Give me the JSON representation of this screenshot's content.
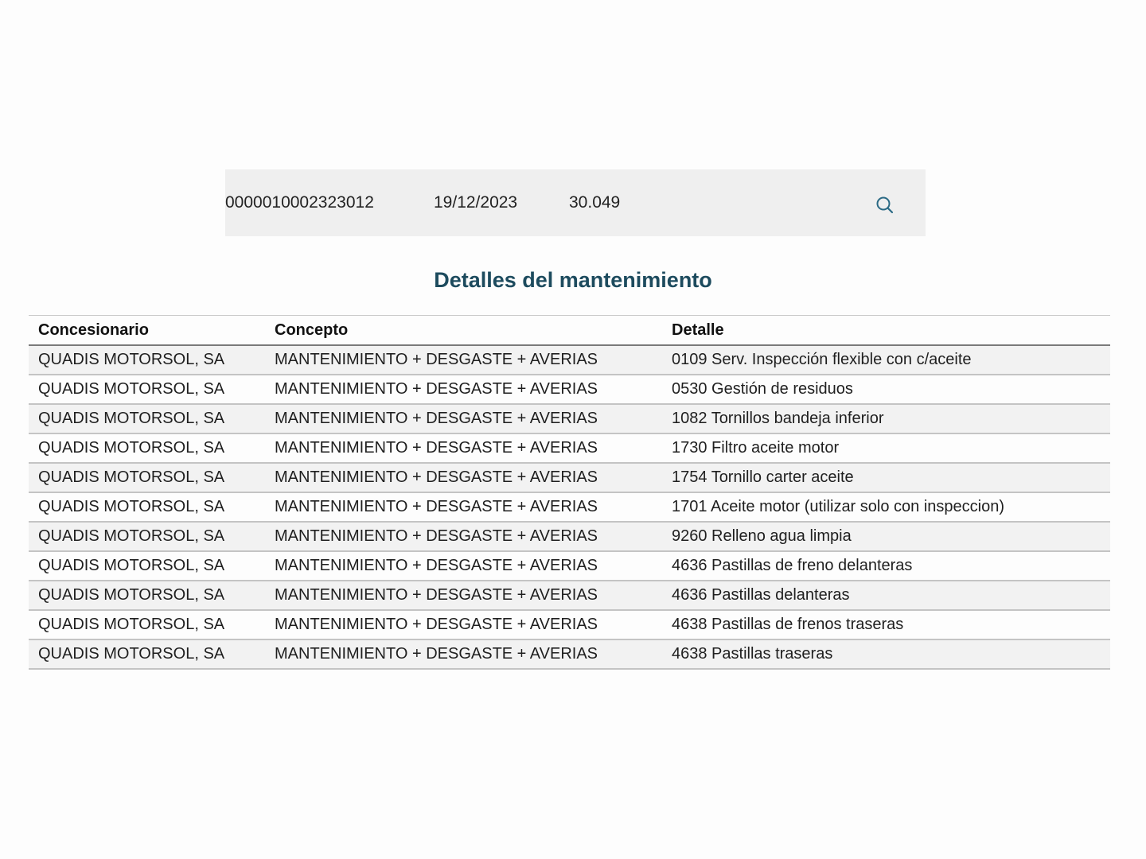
{
  "summary": {
    "reference": "0000010002323012",
    "date": "19/12/2023",
    "kilometers": "30.049",
    "search_icon": "search-icon"
  },
  "title": "Detalles del mantenimiento",
  "table": {
    "headers": [
      "Concesionario",
      "Concepto",
      "Detalle"
    ],
    "rows": [
      [
        "QUADIS MOTORSOL, SA",
        "MANTENIMIENTO + DESGASTE + AVERIAS",
        "0109 Serv. Inspección flexible con c/aceite"
      ],
      [
        "QUADIS MOTORSOL, SA",
        "MANTENIMIENTO + DESGASTE + AVERIAS",
        "0530 Gestión de residuos"
      ],
      [
        "QUADIS MOTORSOL, SA",
        "MANTENIMIENTO + DESGASTE + AVERIAS",
        "1082 Tornillos bandeja inferior"
      ],
      [
        "QUADIS MOTORSOL, SA",
        "MANTENIMIENTO + DESGASTE + AVERIAS",
        "1730 Filtro aceite motor"
      ],
      [
        "QUADIS MOTORSOL, SA",
        "MANTENIMIENTO + DESGASTE + AVERIAS",
        "1754 Tornillo carter aceite"
      ],
      [
        "QUADIS MOTORSOL, SA",
        "MANTENIMIENTO + DESGASTE + AVERIAS",
        "1701 Aceite motor (utilizar solo con inspeccion)"
      ],
      [
        "QUADIS MOTORSOL, SA",
        "MANTENIMIENTO + DESGASTE + AVERIAS",
        "9260 Relleno agua limpia"
      ],
      [
        "QUADIS MOTORSOL, SA",
        "MANTENIMIENTO + DESGASTE + AVERIAS",
        "4636 Pastillas de freno delanteras"
      ],
      [
        "QUADIS MOTORSOL, SA",
        "MANTENIMIENTO + DESGASTE + AVERIAS",
        "4636 Pastillas delanteras"
      ],
      [
        "QUADIS MOTORSOL, SA",
        "MANTENIMIENTO + DESGASTE + AVERIAS",
        "4638 Pastillas de frenos traseras"
      ],
      [
        "QUADIS MOTORSOL, SA",
        "MANTENIMIENTO + DESGASTE + AVERIAS",
        "4638 Pastillas traseras"
      ]
    ]
  },
  "colors": {
    "title": "#1d4b5e",
    "icon": "#2b6a85",
    "summary_bg": "#efefef"
  }
}
